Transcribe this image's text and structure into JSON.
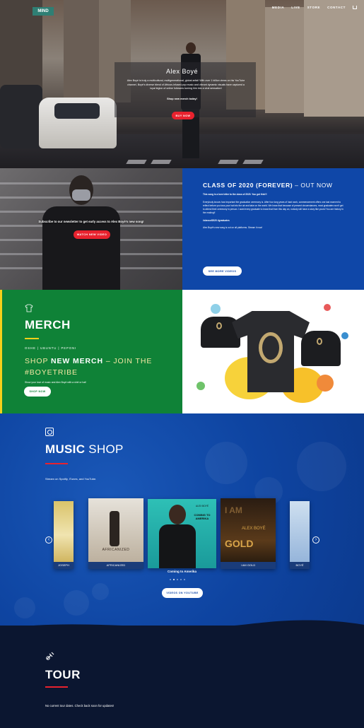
{
  "nav": {
    "items": [
      "MEDIA",
      "LIVE",
      "STORE",
      "CONTACT"
    ]
  },
  "hero": {
    "street_sign": "MIND",
    "title": "Alex Boyé",
    "text": "Alex Boyé is truly a multicultural, multigenerational, global artist! With over 1 billion views on his YouTube channel, Boyé's diverse blend of African-infused pop music and vibrant dynamic visuals have captured a loyal legion of online followers turning him into a viral sensation!",
    "link": "Shop new merch today!",
    "button": "BUY NOW"
  },
  "newsletter": {
    "text": "Subscribe to our newsletter to get early access to Alex Boyé's new song!",
    "button": "WATCH NEW VIDEO"
  },
  "class2020": {
    "title_bold": "CLASS OF 2020 (FOREVER)",
    "title_rest": " – OUT NOW",
    "p1": "This song is a love letter to the class of 2020. You got this!!!",
    "p2": "Everybody knows how important the graduation ceremony is. After four long years of hard work, commencement offers one last moment to reflect before you toss your hat into the air and take on the world. We know that because of present circumstances, most graduates won't get to attend their ceremony in person. I want every graduate to know that from this day on, nobody will have a story like yours! You are history in the making!!",
    "p3": "#classof2020 #graduates",
    "p4": "Alex Boyé's new song is out on all platforms. Stream it now!",
    "button": "SEE MORE VIDEOS"
  },
  "merch": {
    "title": "MERCH",
    "sub": "OSHE | UBUNTU | PEPONI",
    "shop_a": "SHOP ",
    "shop_b": "NEW MERCH",
    "shop_c": " – JOIN THE #BOYETRIBE",
    "desc": "Show your love of music and Alex Boyé with a shirt or hat!",
    "button": "SHOP NOW"
  },
  "music": {
    "title_bold": "MUSIC",
    "title_rest": " SHOP",
    "sub": "Stream on Spotify, iTunes, and YouTube.",
    "albums": [
      {
        "caption": "JOSEPH"
      },
      {
        "caption": "AFRICANIZED",
        "cover": "AFRICANIZED"
      },
      {
        "caption": "Coming to Amerika",
        "cover_top": "ALEX BOYÉ",
        "cover_mid": "COMING TO AMERIKA"
      },
      {
        "caption": "I AM GOLD",
        "cover_a": "I AM",
        "cover_b": "ALEX BOYÉ",
        "cover_c": "GOLD"
      },
      {
        "caption": "BOYÉ"
      }
    ],
    "prev": "‹",
    "next": "›",
    "button": "VIDEOS ON YOUTUBE"
  },
  "tour": {
    "title": "TOUR",
    "sub": "No current tour dates. Check back soon for updates!"
  },
  "colors": {
    "red": "#e8222e",
    "blue": "#0f47a8",
    "green": "#0f8237",
    "yellow": "#f6d01a",
    "navy": "#0b1630"
  }
}
